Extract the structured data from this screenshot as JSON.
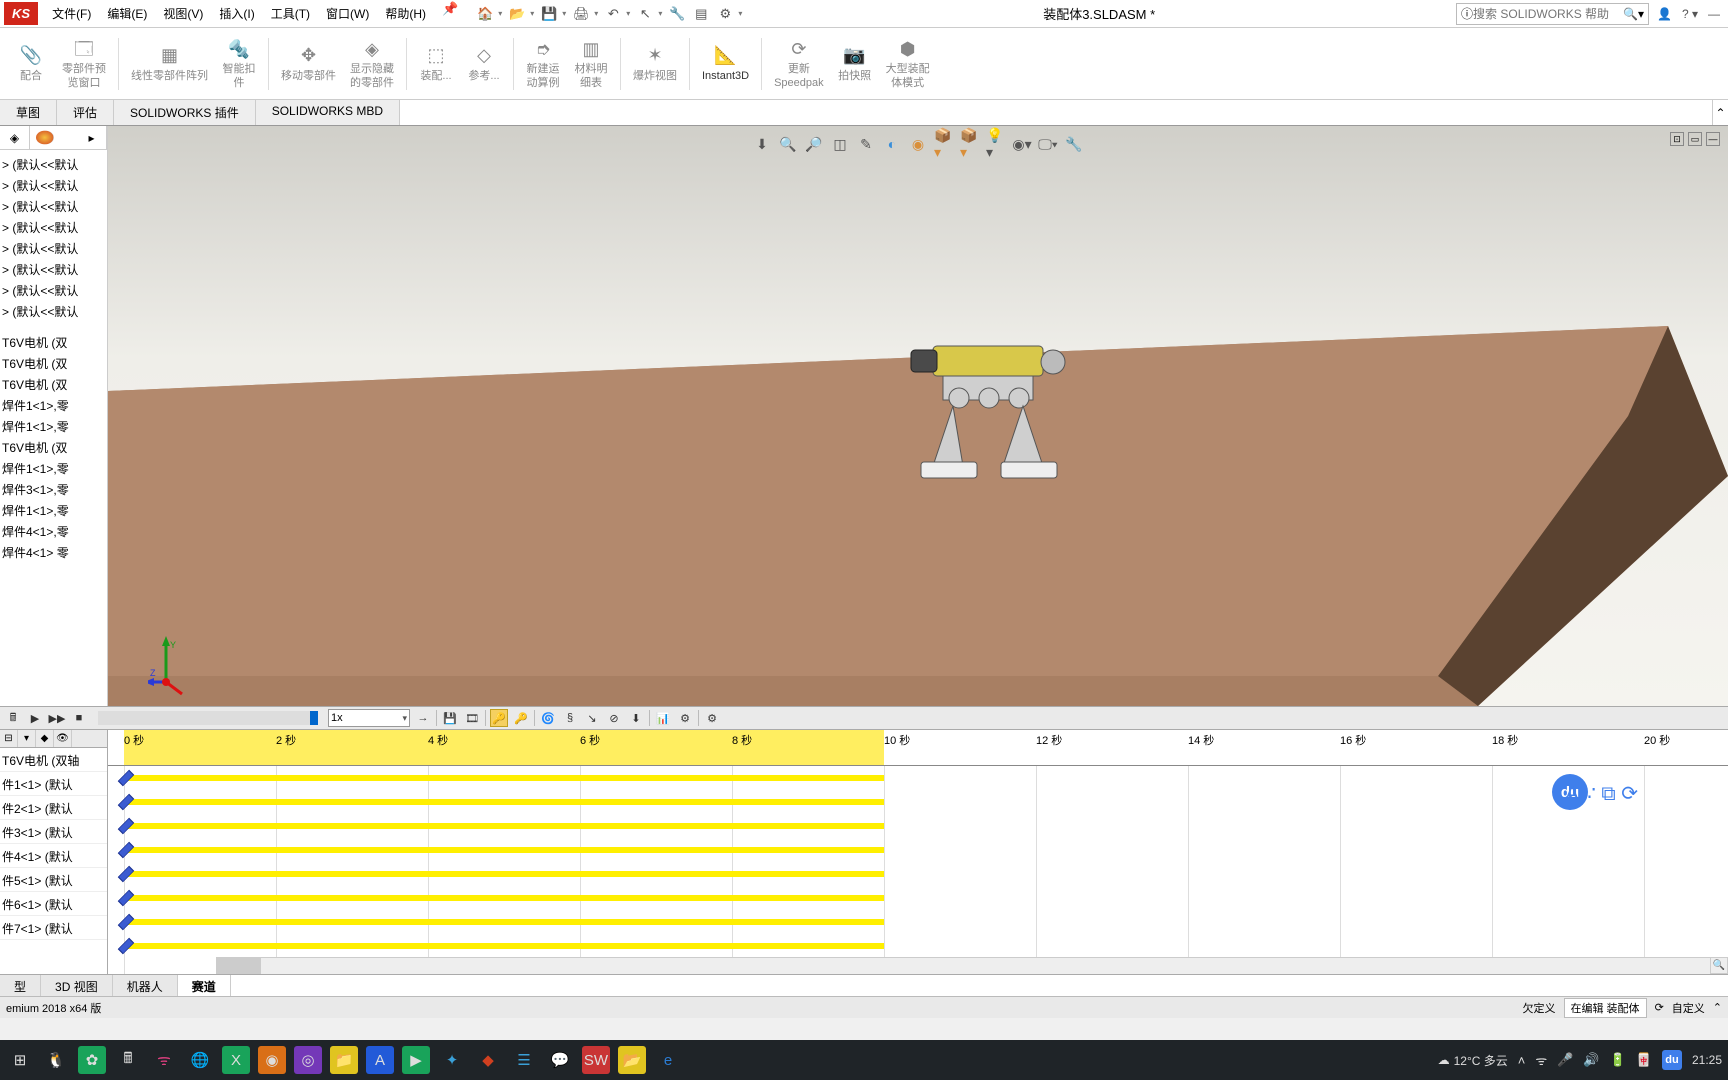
{
  "app": {
    "brand": "KS",
    "title": "装配体3.SLDASM *",
    "search_placeholder": "搜索 SOLIDWORKS 帮助"
  },
  "menu": {
    "file": "文件(F)",
    "edit": "编辑(E)",
    "view": "视图(V)",
    "insert": "插入(I)",
    "tools": "工具(T)",
    "window": "窗口(W)",
    "help": "帮助(H)"
  },
  "ribbon": {
    "mate": "配合",
    "comp_preview": "零部件预\n览窗口",
    "linear_pattern": "线性零部件阵列",
    "smart_fastener": "智能扣\n件",
    "move_comp": "移动零部件",
    "show_hidden": "显示隐藏\n的零部件",
    "assy_feat": "装配...",
    "reference": "参考...",
    "new_motion": "新建运\n动算例",
    "bom": "材料明\n细表",
    "exploded": "爆炸视图",
    "instant3d": "Instant3D",
    "update_speedpak": "更新\nSpeedpak",
    "snapshot": "拍快照",
    "large_assy": "大型装配\n体模式"
  },
  "feature_tabs": [
    "草图",
    "评估",
    "SOLIDWORKS 插件",
    "SOLIDWORKS MBD"
  ],
  "tree_items_top": [
    "> (默认<<默认",
    "> (默认<<默认",
    "> (默认<<默认",
    "> (默认<<默认",
    "> (默认<<默认",
    "> (默认<<默认",
    "> (默认<<默认",
    "> (默认<<默认"
  ],
  "tree_items_mid": [
    "T6V电机 (双",
    "T6V电机 (双",
    "T6V电机 (双",
    "焊件1<1>,零",
    "焊件1<1>,零",
    "T6V电机 (双",
    "焊件1<1>,零",
    "焊件3<1>,零",
    "焊件1<1>,零",
    "焊件4<1>,零",
    "焊件4<1> 零"
  ],
  "motion_tree": [
    "T6V电机 (双轴",
    "件1<1> (默认",
    "件2<1> (默认",
    "件3<1> (默认",
    "件4<1> (默认",
    "件5<1> (默认",
    "件6<1> (默认",
    "件7<1> (默认"
  ],
  "timeline_ticks": [
    "0 秒",
    "2 秒",
    "4 秒",
    "6 秒",
    "8 秒",
    "10 秒",
    "12 秒",
    "14 秒",
    "16 秒",
    "18 秒",
    "20 秒"
  ],
  "speed": "1x",
  "bottom_tabs": [
    "型",
    "3D 视图",
    "机器人",
    "赛道"
  ],
  "status": {
    "version": "emium 2018 x64 版",
    "undef": "欠定义",
    "editing": "在编辑 装配体",
    "custom": "自定义"
  },
  "taskbar": {
    "weather": "12°C 多云",
    "time": "21:25"
  }
}
